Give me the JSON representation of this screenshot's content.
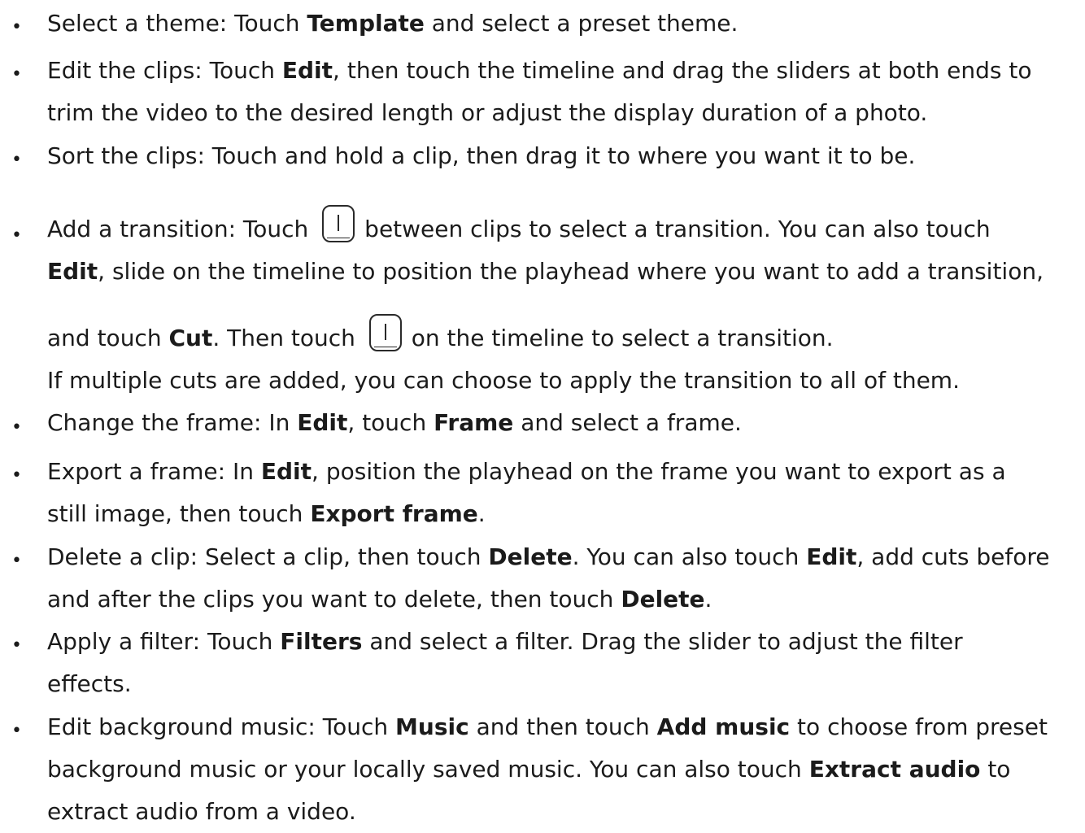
{
  "bullet_glyph": "•",
  "items": [
    {
      "lines": [
        [
          "Select a theme: Touch ",
          "Template",
          " and select a preset theme."
        ]
      ]
    },
    {
      "lines": [
        [
          "Edit the clips: Touch ",
          "Edit",
          ", then touch the timeline and drag the sliders at both ends to"
        ],
        [
          "trim the video to the desired length or adjust the display duration of a photo."
        ]
      ]
    },
    {
      "lines": [
        [
          "Sort the clips: Touch and hold a clip, then drag it to where you want it to be."
        ]
      ]
    },
    {
      "icon_name": "transition-icon",
      "lines": [
        [
          "Add a transition: Touch ",
          "between clips to select a transition. You can also touch"
        ],
        [
          "Edit",
          ", slide on the timeline to position the playhead where you want to add a transition,"
        ],
        [
          "and touch ",
          "Cut",
          ". Then touch ",
          "on the timeline to select a transition."
        ],
        [
          "If multiple cuts are added, you can choose to apply the transition to all of them."
        ]
      ]
    },
    {
      "lines": [
        [
          "Change the frame: In ",
          "Edit",
          ", touch ",
          "Frame",
          " and select a frame."
        ]
      ]
    },
    {
      "lines": [
        [
          "Export a frame: In ",
          "Edit",
          ", position the playhead on the frame you want to export as a"
        ],
        [
          "still image, then touch ",
          "Export frame",
          "."
        ]
      ]
    },
    {
      "lines": [
        [
          "Delete a clip: Select a clip, then touch ",
          "Delete",
          ". You can also touch ",
          "Edit",
          ", add cuts before"
        ],
        [
          "and after the clips you want to delete, then touch ",
          "Delete",
          "."
        ]
      ]
    },
    {
      "lines": [
        [
          "Apply a filter: Touch ",
          "Filters",
          " and select a filter. Drag the slider to adjust the filter"
        ],
        [
          "effects."
        ]
      ]
    },
    {
      "lines": [
        [
          "Edit background music: Touch ",
          "Music",
          " and then touch ",
          "Add music",
          " to choose from preset"
        ],
        [
          "background music or your locally saved music. You can also touch ",
          "Extract audio",
          " to"
        ],
        [
          "extract audio from a video."
        ]
      ]
    }
  ]
}
